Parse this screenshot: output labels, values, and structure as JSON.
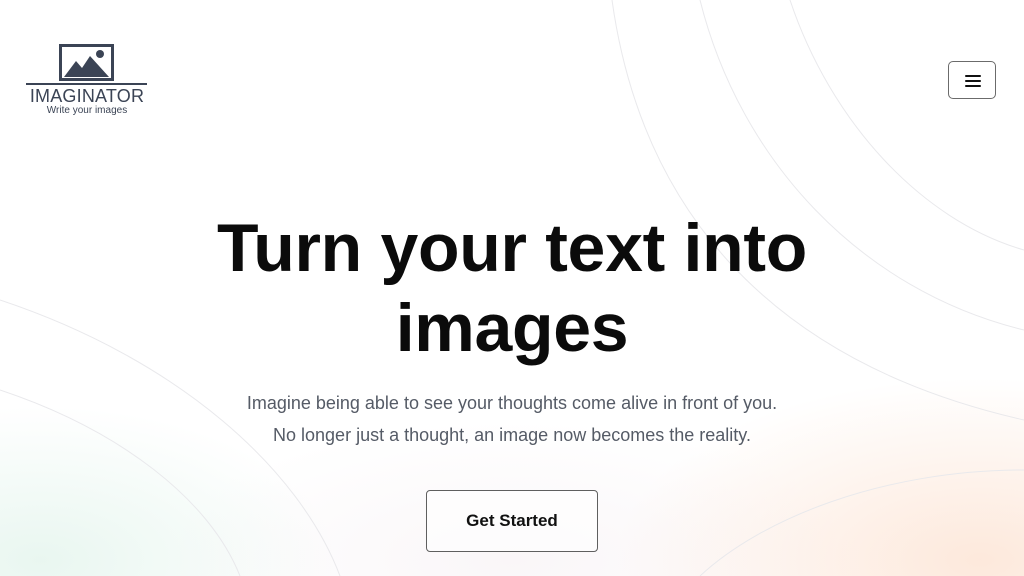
{
  "logo": {
    "name": "IMAGINATOR",
    "tagline": "Write your images",
    "icon": "landscape-picture-icon",
    "color": "#3b4455"
  },
  "header": {
    "menu_icon": "hamburger-menu-icon"
  },
  "hero": {
    "title": "Turn your text into images",
    "subtitle_line1": "Imagine being able to see your thoughts come alive in front of you.",
    "subtitle_line2": "No longer just a thought, an image now becomes the reality.",
    "cta_label": "Get Started"
  },
  "colors": {
    "title": "#0b0b0b",
    "subtitle": "#555b66",
    "bg_warm": "#fbd6be",
    "bg_cool": "#ceecde"
  }
}
